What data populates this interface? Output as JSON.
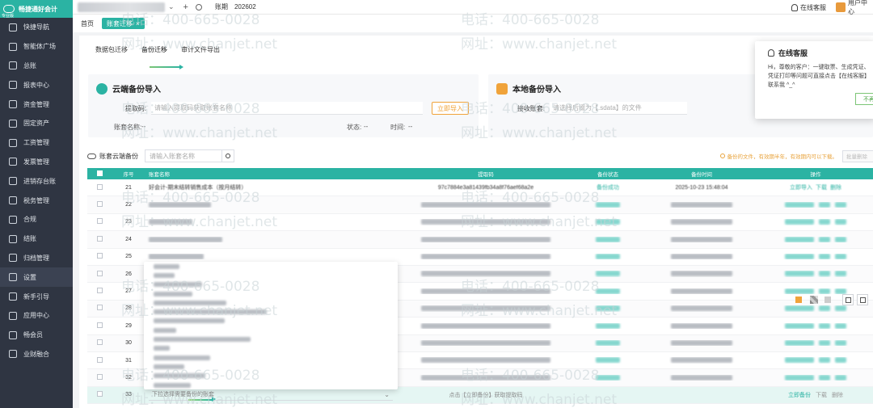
{
  "app": {
    "logo_title": "畅捷通好会计",
    "logo_sub": "专业版"
  },
  "sidebar": {
    "items": [
      {
        "label": "快捷导航",
        "icon": "home-icon"
      },
      {
        "label": "智能体广场",
        "icon": "ai-icon"
      },
      {
        "label": "总账",
        "icon": "ledger-icon"
      },
      {
        "label": "报表中心",
        "icon": "report-icon"
      },
      {
        "label": "资金管理",
        "icon": "money-icon"
      },
      {
        "label": "固定资产",
        "icon": "asset-icon"
      },
      {
        "label": "工资管理",
        "icon": "salary-icon"
      },
      {
        "label": "发票管理",
        "icon": "invoice-icon"
      },
      {
        "label": "进销存台账",
        "icon": "inventory-icon"
      },
      {
        "label": "税务管理",
        "icon": "tax-icon"
      },
      {
        "label": "合规",
        "icon": "compliance-icon"
      },
      {
        "label": "结账",
        "icon": "close-book-icon"
      },
      {
        "label": "归档管理",
        "icon": "archive-icon"
      },
      {
        "label": "设置",
        "icon": "gear-icon"
      },
      {
        "label": "新手引导",
        "icon": "guide-icon"
      },
      {
        "label": "应用中心",
        "icon": "apps-icon"
      },
      {
        "label": "畅会员",
        "icon": "member-icon"
      },
      {
        "label": "业财融合",
        "icon": "integration-icon"
      }
    ],
    "active_index": 13
  },
  "topbar": {
    "period_label": "账期",
    "period_value": "202602",
    "customer_service": "在线客服",
    "user_label": "用户中心"
  },
  "tabs": [
    {
      "label": "首页"
    },
    {
      "label": "账套迁移",
      "close": "×"
    }
  ],
  "subtabs": [
    {
      "label": "数据包迁移"
    },
    {
      "label": "备份迁移"
    },
    {
      "label": "审计文件导出"
    }
  ],
  "cloud_panel": {
    "title": "云端备份导入",
    "code_label": "提取码:",
    "code_placeholder": "请输入提取码获取账套名称",
    "import_button": "立即导入",
    "account_name_label": "账套名称:",
    "account_name_value": "--",
    "status_label": "状态:",
    "status_value": "--",
    "time_label": "时间:",
    "time_value": "--"
  },
  "local_panel": {
    "title": "本地备份导入",
    "receive_label": "接收账套:",
    "receive_placeholder": "请选择后缀为【.sdata】的文件"
  },
  "toolbar": {
    "title": "账套云端备份",
    "search_placeholder": "请输入账套名称",
    "tip": "备份的文件，有效期半年，有效期内可以下载。",
    "batch_delete": "批量删除"
  },
  "table": {
    "columns": [
      "序号",
      "账套名称",
      "提取码",
      "备份状态",
      "备份时间",
      "操作"
    ],
    "rows": [
      {
        "no": "21",
        "name": "好会计-期末结转销售成本（按月结转）",
        "code": "97c7884e3a81439fb34a8f76aef68a2e",
        "status": "备份成功",
        "time": "2025-10-23 15:48:04",
        "ops": [
          "立即导入",
          "下载",
          "删除"
        ]
      },
      {
        "no": "22"
      },
      {
        "no": "23"
      },
      {
        "no": "24"
      },
      {
        "no": "25"
      },
      {
        "no": "26"
      },
      {
        "no": "27"
      },
      {
        "no": "28"
      },
      {
        "no": "29"
      },
      {
        "no": "30"
      },
      {
        "no": "31"
      },
      {
        "no": "32"
      }
    ],
    "last_row": {
      "no": "33",
      "select_placeholder": "下拉选择需要备份的账套",
      "code_hint": "点击【立即备份】获取提取码",
      "ops": [
        "立即备份",
        "下载",
        "删除"
      ]
    }
  },
  "popup": {
    "title": "在线客服",
    "body": "Hi，尊敬的客户：一键取票、生成凭证、凭证打印等问题可直接点击【在线客服】联系我 ^_^",
    "button": "不再"
  },
  "watermark": {
    "phone": "电话：400-665-0028",
    "site": "网址：www.chanjet.net"
  },
  "colors": {
    "accent": "#2bb3a3",
    "sidebar": "#2f3542",
    "warning": "#f0a33a"
  }
}
